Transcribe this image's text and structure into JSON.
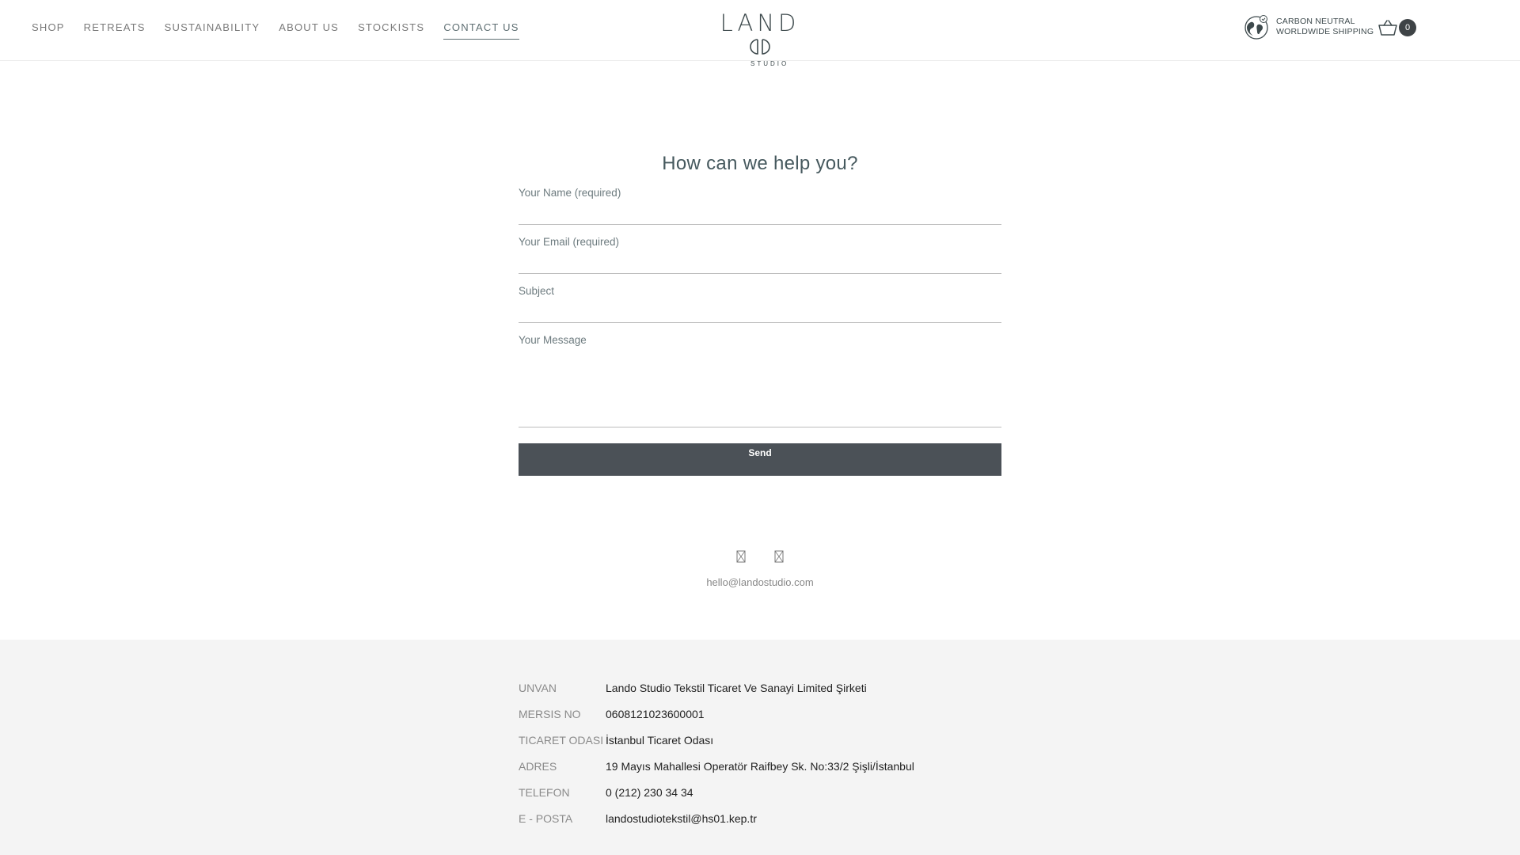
{
  "nav": {
    "items": [
      {
        "label": "SHOP"
      },
      {
        "label": "RETREATS"
      },
      {
        "label": "SUSTAINABILITY"
      },
      {
        "label": "ABOUT US"
      },
      {
        "label": "STOCKISTS"
      },
      {
        "label": "CONTACT US",
        "active": true
      }
    ]
  },
  "logo": {
    "main": "LAND",
    "sub": "STUDIO"
  },
  "badge": {
    "line1": "CARBON NEUTRAL",
    "line2": "WORLDWIDE SHIPPING",
    "icon": "globe-icon"
  },
  "cart": {
    "count": "0",
    "icon": "basket-icon"
  },
  "form": {
    "title": "How can we help you?",
    "name_label": "Your Name (required)",
    "email_label": "Your Email (required)",
    "subject_label": "Subject",
    "message_label": "Your Message",
    "send_label": "Send"
  },
  "contact": {
    "email": "hello@landostudio.com",
    "icons": [
      "broken-glyph-icon",
      "broken-glyph-icon"
    ]
  },
  "company": {
    "rows": [
      {
        "key": "UNVAN",
        "value": "Lando Studio Tekstil Ticaret Ve Sanayi Limited Şirketi"
      },
      {
        "key": "MERSIS NO",
        "value": "0608121023600001"
      },
      {
        "key": "TICARET ODASI",
        "value": "İstanbul Ticaret Odası"
      },
      {
        "key": "ADRES",
        "value": "19 Mayıs Mahallesi Operatör Raifbey Sk. No:33/2 Şişli/İstanbul"
      },
      {
        "key": "TELEFON",
        "value": "0 (212) 230 34 34"
      },
      {
        "key": "E - POSTA",
        "value": "landostudiotekstil@hs01.kep.tr"
      }
    ]
  },
  "colors": {
    "accent": "#5f6f73",
    "button": "#4b5157",
    "footer_bg": "#f4f4f4"
  }
}
